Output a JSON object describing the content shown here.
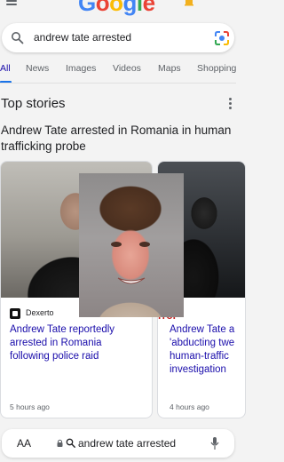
{
  "header": {
    "logo_letters": [
      "G",
      "o",
      "o",
      "g",
      "l",
      "e"
    ],
    "logo_colors": [
      "#4285F4",
      "#EA4335",
      "#FBBC05",
      "#4285F4",
      "#34A853",
      "#EA4335"
    ],
    "menu_icon": "hamburger-icon",
    "notification_icon": "bell-icon"
  },
  "search": {
    "query": "andrew tate arrested",
    "search_icon": "search-icon",
    "lens_icon": "camera-lens-icon"
  },
  "tabs": [
    {
      "label": "All",
      "active": true
    },
    {
      "label": "News",
      "active": false
    },
    {
      "label": "Images",
      "active": false
    },
    {
      "label": "Videos",
      "active": false
    },
    {
      "label": "Maps",
      "active": false
    },
    {
      "label": "Shopping",
      "active": false
    }
  ],
  "top_stories": {
    "title": "Top stories",
    "headline": "Andrew Tate arrested in Romania in human trafficking probe",
    "cards": [
      {
        "source": "Dexerto",
        "title": "Andrew Tate reportedly arrested in Romania following police raid",
        "time": "5 hours ago"
      },
      {
        "source": "rror",
        "title": "Andrew Tate a 'abducting twe human-traffic investigation",
        "time": "4 hours ago"
      }
    ]
  },
  "address_bar": {
    "text_size_label": "AA",
    "url_text": "andrew tate arrested",
    "lock_icon": "lock-icon",
    "mic_icon": "microphone-icon"
  },
  "colors": {
    "link": "#1a0dab",
    "accent": "#1a73e8",
    "background": "#f3f3f3"
  }
}
